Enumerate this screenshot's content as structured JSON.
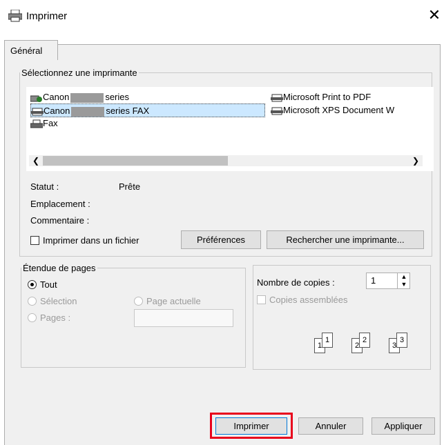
{
  "window": {
    "title": "Imprimer",
    "close_glyph": "✕"
  },
  "tabs": [
    {
      "label": "Général"
    }
  ],
  "printer_group": {
    "legend": "Sélectionnez une imprimante",
    "printers": [
      {
        "icon": "printer-icon",
        "name_prefix": "Canon",
        "name_suffix": "series"
      },
      {
        "icon": "fax-printer-icon",
        "name_prefix": "Canon",
        "name_suffix": "series FAX",
        "selected": true
      },
      {
        "icon": "fax-icon",
        "name": "Fax"
      },
      {
        "icon": "pdf-printer-icon",
        "name": "Microsoft Print to PDF"
      },
      {
        "icon": "xps-printer-icon",
        "name": "Microsoft XPS Document W"
      }
    ],
    "status_label": "Statut :",
    "status_value": "Prête",
    "location_label": "Emplacement :",
    "comment_label": "Commentaire :",
    "print_to_file_label": "Imprimer dans un fichier",
    "preferences_button": "Préférences",
    "find_printer_button": "Rechercher une imprimante..."
  },
  "page_range": {
    "legend": "Étendue de pages",
    "all": "Tout",
    "selection": "Sélection",
    "current_page": "Page actuelle",
    "pages": "Pages :"
  },
  "copies": {
    "label": "Nombre de copies :",
    "value": "1",
    "collate_label": "Copies assemblées",
    "collate_icons": [
      "1",
      "1",
      "2",
      "2",
      "3",
      "3"
    ]
  },
  "footer": {
    "print_button": "Imprimer",
    "cancel_button": "Annuler",
    "apply_button": "Appliquer",
    "highlight_color": "#e8001c"
  },
  "colors": {
    "selection": "#cce8ff",
    "dialog_bg": "#f0f0f0"
  }
}
